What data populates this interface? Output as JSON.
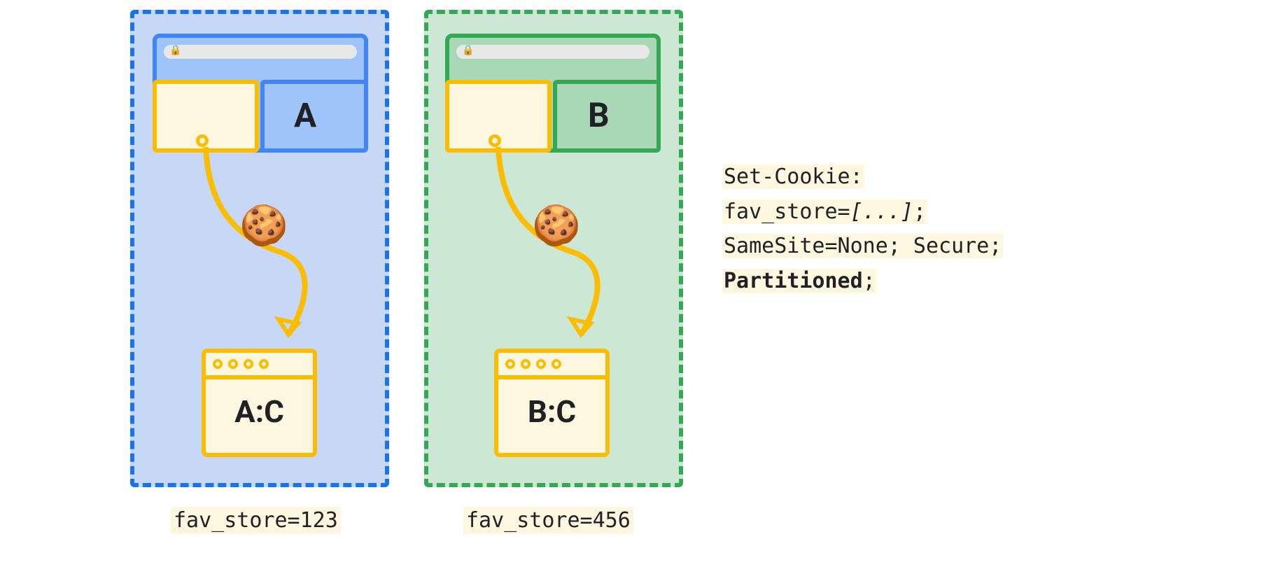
{
  "partitions": {
    "a": {
      "label": "A",
      "jar_label": "A:C",
      "fav": "fav_store=123"
    },
    "b": {
      "label": "B",
      "jar_label": "B:C",
      "fav": "fav_store=456"
    }
  },
  "code": {
    "line1": "Set-Cookie:",
    "line2_prefix": "fav_store=",
    "line2_value": "[...]",
    "line2_suffix": ";",
    "line3": "SameSite=None; Secure;",
    "line4_bold": "Partitioned",
    "line4_suffix": ";"
  },
  "icons": {
    "cookie": "🍪",
    "lock": "🔒"
  }
}
